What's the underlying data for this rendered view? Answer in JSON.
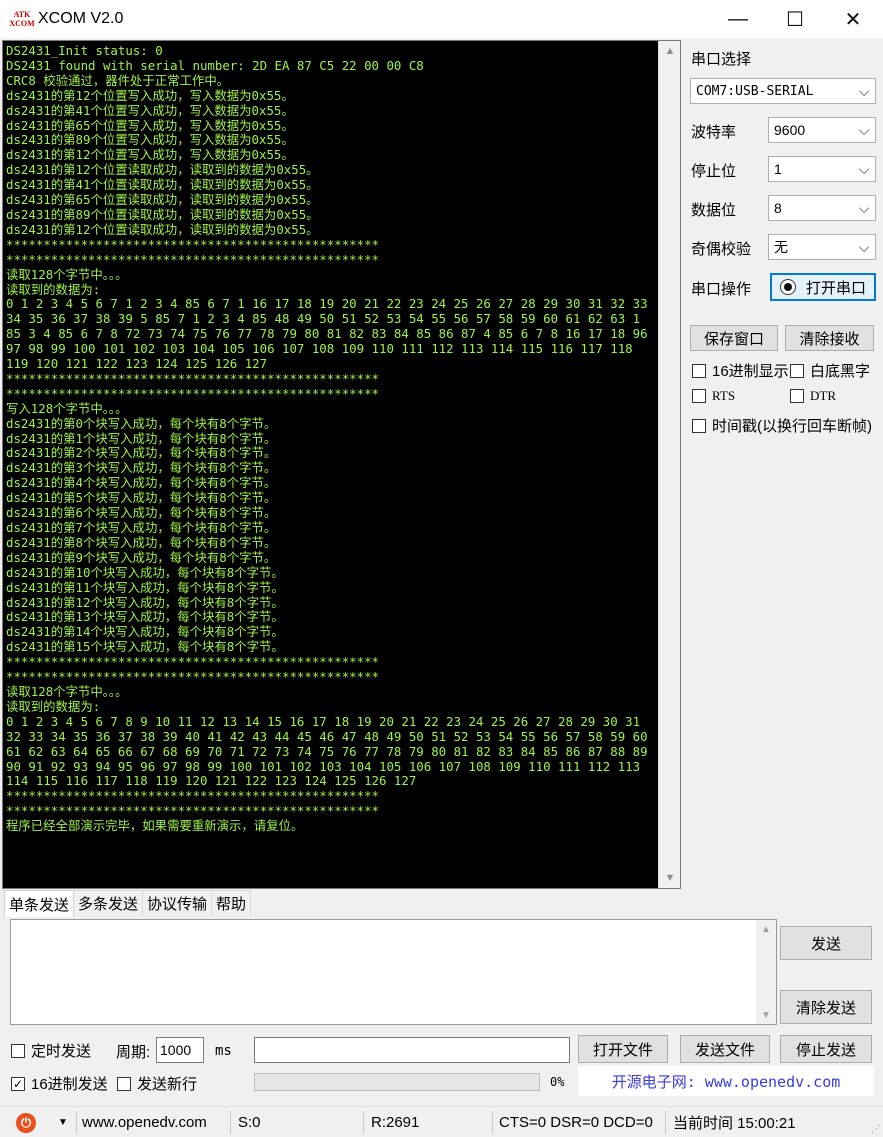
{
  "window": {
    "logo_top": "ATK",
    "logo_bottom": "XCOM",
    "title": "XCOM V2.0",
    "min_glyph": "—",
    "max_glyph": "☐",
    "close_glyph": "✕"
  },
  "terminal": {
    "lines": [
      "DS2431_Init status: 0",
      "DS2431 found with serial number: 2D EA 87 C5 22 00 00 C8",
      "CRC8 校验通过，器件处于正常工作中。",
      "ds2431的第12个位置写入成功，写入数据为0x55。",
      "ds2431的第41个位置写入成功，写入数据为0x55。",
      "ds2431的第65个位置写入成功，写入数据为0x55。",
      "ds2431的第89个位置写入成功，写入数据为0x55。",
      "ds2431的第12个位置写入成功，写入数据为0x55。",
      "ds2431的第12个位置读取成功，读取到的数据为0x55。",
      "ds2431的第41个位置读取成功，读取到的数据为0x55。",
      "ds2431的第65个位置读取成功，读取到的数据为0x55。",
      "ds2431的第89个位置读取成功，读取到的数据为0x55。",
      "ds2431的第12个位置读取成功，读取到的数据为0x55。",
      "**************************************************",
      "**************************************************",
      "读取128个字节中。。。",
      "读取到的数据为:",
      "0 1 2 3 4 5 6 7 1 2 3 4 85 6 7 1 16 17 18 19 20 21 22 23 24 25 26 27 28 29 30 31 32 33",
      "34 35 36 37 38 39 5 85 7 1 2 3 4 85 48 49 50 51 52 53 54 55 56 57 58 59 60 61 62 63 1",
      "85 3 4 85 6 7 8 72 73 74 75 76 77 78 79 80 81 82 83 84 85 86 87 4 85 6 7 8 16 17 18 96",
      "97 98 99 100 101 102 103 104 105 106 107 108 109 110 111 112 113 114 115 116 117 118",
      "119 120 121 122 123 124 125 126 127",
      "**************************************************",
      "**************************************************",
      "写入128个字节中。。。",
      "ds2431的第0个块写入成功，每个块有8个字节。",
      "ds2431的第1个块写入成功，每个块有8个字节。",
      "ds2431的第2个块写入成功，每个块有8个字节。",
      "ds2431的第3个块写入成功，每个块有8个字节。",
      "ds2431的第4个块写入成功，每个块有8个字节。",
      "ds2431的第5个块写入成功，每个块有8个字节。",
      "ds2431的第6个块写入成功，每个块有8个字节。",
      "ds2431的第7个块写入成功，每个块有8个字节。",
      "ds2431的第8个块写入成功，每个块有8个字节。",
      "ds2431的第9个块写入成功，每个块有8个字节。",
      "ds2431的第10个块写入成功，每个块有8个字节。",
      "ds2431的第11个块写入成功，每个块有8个字节。",
      "ds2431的第12个块写入成功，每个块有8个字节。",
      "ds2431的第13个块写入成功，每个块有8个字节。",
      "ds2431的第14个块写入成功，每个块有8个字节。",
      "ds2431的第15个块写入成功，每个块有8个字节。",
      "**************************************************",
      "**************************************************",
      "读取128个字节中。。。",
      "读取到的数据为:",
      "0 1 2 3 4 5 6 7 8 9 10 11 12 13 14 15 16 17 18 19 20 21 22 23 24 25 26 27 28 29 30 31",
      "32 33 34 35 36 37 38 39 40 41 42 43 44 45 46 47 48 49 50 51 52 53 54 55 56 57 58 59 60",
      "61 62 63 64 65 66 67 68 69 70 71 72 73 74 75 76 77 78 79 80 81 82 83 84 85 86 87 88 89",
      "90 91 92 93 94 95 96 97 98 99 100 101 102 103 104 105 106 107 108 109 110 111 112 113",
      "114 115 116 117 118 119 120 121 122 123 124 125 126 127",
      "**************************************************",
      "**************************************************",
      "程序已经全部演示完毕，如果需要重新演示，请复位。"
    ]
  },
  "panel": {
    "port_select_label": "串口选择",
    "port_value": "COM7:USB-SERIAL",
    "baud_label": "波特率",
    "baud_value": "9600",
    "stop_label": "停止位",
    "stop_value": "1",
    "data_label": "数据位",
    "data_value": "8",
    "parity_label": "奇偶校验",
    "parity_value": "无",
    "op_label": "串口操作",
    "open_port_button": "打开串口",
    "save_window_button": "保存窗口",
    "clear_receive_button": "清除接收",
    "hex_display": "16进制显示",
    "white_bg": "白底黑字",
    "rts": "RTS",
    "dtr": "DTR",
    "timestamp": "时间戳(以换行回车断帧)"
  },
  "tabs": [
    "单条发送",
    "多条发送",
    "协议传输",
    "帮助"
  ],
  "send": {
    "send_button": "发送",
    "clear_send_button": "清除发送",
    "timed_send": "定时发送",
    "period_label": "周期:",
    "period_value": "1000",
    "ms_label": "ms",
    "open_file_button": "打开文件",
    "send_file_button": "发送文件",
    "stop_send_button": "停止发送",
    "hex_send": "16进制发送",
    "hex_send_checked": "✓",
    "send_newline": "发送新行",
    "progress_text": "0%",
    "progress_fraction": 0,
    "promo": "开源电子网: www.openedv.com"
  },
  "statusbar": {
    "icon_glyph": "⏻",
    "dropdown_glyph": "▼",
    "website": "www.openedv.com",
    "s_count": "S:0",
    "r_count": "R:2691",
    "signals": "CTS=0 DSR=0 DCD=0",
    "time": "当前时间 15:00:21"
  },
  "colors": {
    "terminal_bg": "#000000",
    "terminal_text": "#a0f04a",
    "accent": "#0078d7",
    "promo_text": "#3a3ae0"
  }
}
